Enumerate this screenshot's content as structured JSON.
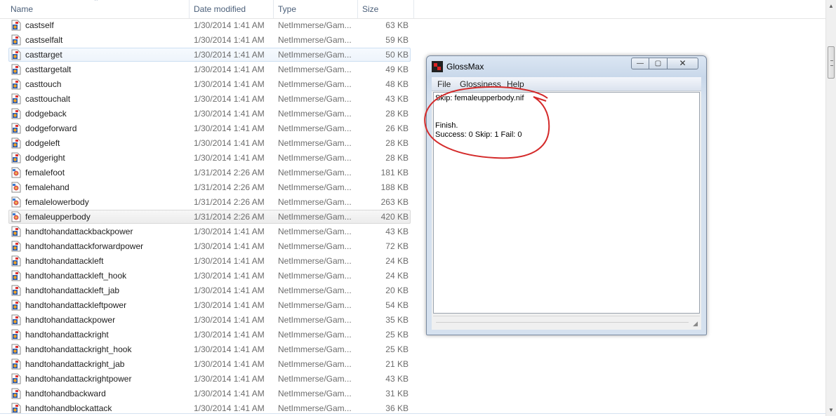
{
  "explorer": {
    "columns": [
      {
        "key": "name",
        "label": "Name"
      },
      {
        "key": "date",
        "label": "Date modified"
      },
      {
        "key": "type",
        "label": "Type"
      },
      {
        "key": "size",
        "label": "Size"
      }
    ],
    "sort_indicator": "^",
    "rows": [
      {
        "name": "castself",
        "date": "1/30/2014 1:41 AM",
        "type": "NetImmerse/Gam...",
        "size": "63 KB",
        "icon": "nif-file-icon"
      },
      {
        "name": "castselfalt",
        "date": "1/30/2014 1:41 AM",
        "type": "NetImmerse/Gam...",
        "size": "59 KB",
        "icon": "nif-file-icon"
      },
      {
        "name": "casttarget",
        "date": "1/30/2014 1:41 AM",
        "type": "NetImmerse/Gam...",
        "size": "50 KB",
        "icon": "nif-file-icon",
        "state": "hover"
      },
      {
        "name": "casttargetalt",
        "date": "1/30/2014 1:41 AM",
        "type": "NetImmerse/Gam...",
        "size": "49 KB",
        "icon": "nif-file-icon"
      },
      {
        "name": "casttouch",
        "date": "1/30/2014 1:41 AM",
        "type": "NetImmerse/Gam...",
        "size": "48 KB",
        "icon": "nif-file-icon"
      },
      {
        "name": "casttouchalt",
        "date": "1/30/2014 1:41 AM",
        "type": "NetImmerse/Gam...",
        "size": "43 KB",
        "icon": "nif-file-icon"
      },
      {
        "name": "dodgeback",
        "date": "1/30/2014 1:41 AM",
        "type": "NetImmerse/Gam...",
        "size": "28 KB",
        "icon": "nif-file-icon"
      },
      {
        "name": "dodgeforward",
        "date": "1/30/2014 1:41 AM",
        "type": "NetImmerse/Gam...",
        "size": "26 KB",
        "icon": "nif-file-icon"
      },
      {
        "name": "dodgeleft",
        "date": "1/30/2014 1:41 AM",
        "type": "NetImmerse/Gam...",
        "size": "28 KB",
        "icon": "nif-file-icon"
      },
      {
        "name": "dodgeright",
        "date": "1/30/2014 1:41 AM",
        "type": "NetImmerse/Gam...",
        "size": "28 KB",
        "icon": "nif-file-icon"
      },
      {
        "name": "femalefoot",
        "date": "1/31/2014 2:26 AM",
        "type": "NetImmerse/Gam...",
        "size": "181 KB",
        "icon": "nif-file-icon-alt"
      },
      {
        "name": "femalehand",
        "date": "1/31/2014 2:26 AM",
        "type": "NetImmerse/Gam...",
        "size": "188 KB",
        "icon": "nif-file-icon-alt"
      },
      {
        "name": "femalelowerbody",
        "date": "1/31/2014 2:26 AM",
        "type": "NetImmerse/Gam...",
        "size": "263 KB",
        "icon": "nif-file-icon-alt"
      },
      {
        "name": "femaleupperbody",
        "date": "1/31/2014 2:26 AM",
        "type": "NetImmerse/Gam...",
        "size": "420 KB",
        "icon": "nif-file-icon-alt",
        "state": "selected"
      },
      {
        "name": "handtohandattackbackpower",
        "date": "1/30/2014 1:41 AM",
        "type": "NetImmerse/Gam...",
        "size": "43 KB",
        "icon": "nif-file-icon"
      },
      {
        "name": "handtohandattackforwardpower",
        "date": "1/30/2014 1:41 AM",
        "type": "NetImmerse/Gam...",
        "size": "72 KB",
        "icon": "nif-file-icon"
      },
      {
        "name": "handtohandattackleft",
        "date": "1/30/2014 1:41 AM",
        "type": "NetImmerse/Gam...",
        "size": "24 KB",
        "icon": "nif-file-icon"
      },
      {
        "name": "handtohandattackleft_hook",
        "date": "1/30/2014 1:41 AM",
        "type": "NetImmerse/Gam...",
        "size": "24 KB",
        "icon": "nif-file-icon"
      },
      {
        "name": "handtohandattackleft_jab",
        "date": "1/30/2014 1:41 AM",
        "type": "NetImmerse/Gam...",
        "size": "20 KB",
        "icon": "nif-file-icon"
      },
      {
        "name": "handtohandattackleftpower",
        "date": "1/30/2014 1:41 AM",
        "type": "NetImmerse/Gam...",
        "size": "54 KB",
        "icon": "nif-file-icon"
      },
      {
        "name": "handtohandattackpower",
        "date": "1/30/2014 1:41 AM",
        "type": "NetImmerse/Gam...",
        "size": "35 KB",
        "icon": "nif-file-icon"
      },
      {
        "name": "handtohandattackright",
        "date": "1/30/2014 1:41 AM",
        "type": "NetImmerse/Gam...",
        "size": "25 KB",
        "icon": "nif-file-icon"
      },
      {
        "name": "handtohandattackright_hook",
        "date": "1/30/2014 1:41 AM",
        "type": "NetImmerse/Gam...",
        "size": "25 KB",
        "icon": "nif-file-icon"
      },
      {
        "name": "handtohandattackright_jab",
        "date": "1/30/2014 1:41 AM",
        "type": "NetImmerse/Gam...",
        "size": "21 KB",
        "icon": "nif-file-icon"
      },
      {
        "name": "handtohandattackrightpower",
        "date": "1/30/2014 1:41 AM",
        "type": "NetImmerse/Gam...",
        "size": "43 KB",
        "icon": "nif-file-icon"
      },
      {
        "name": "handtohandbackward",
        "date": "1/30/2014 1:41 AM",
        "type": "NetImmerse/Gam...",
        "size": "31 KB",
        "icon": "nif-file-icon"
      },
      {
        "name": "handtohandblockattack",
        "date": "1/30/2014 1:41 AM",
        "type": "NetImmerse/Gam...",
        "size": "36 KB",
        "icon": "nif-file-icon"
      }
    ]
  },
  "glossmax": {
    "title": "GlossMax",
    "controls": {
      "minimize": "—",
      "maximize": "▢",
      "close": "✕"
    },
    "menu": [
      "File",
      "Glossiness",
      "Help"
    ],
    "output_lines": [
      "Skip: femaleupperbody.nif",
      "",
      "",
      "Finish.",
      "Success: 0 Skip: 1 Fail: 0"
    ],
    "annotation_color": "#d42a2a"
  },
  "scrollbar": {
    "up": "▲",
    "down": "▼"
  }
}
